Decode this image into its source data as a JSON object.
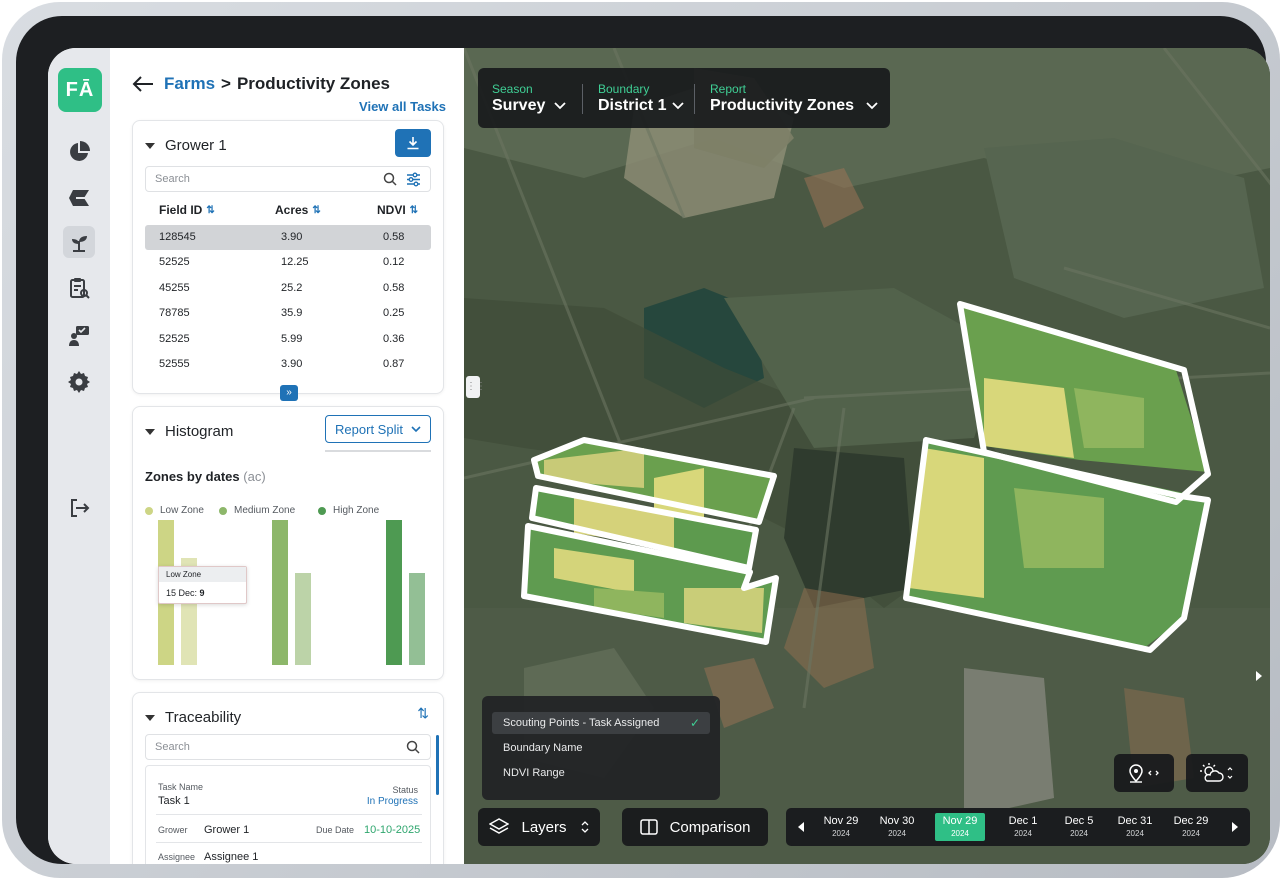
{
  "app": {
    "logo_text": "FĀ"
  },
  "rail": {
    "items": [
      {
        "icon": "pie-chart-icon"
      },
      {
        "icon": "field-layers-icon"
      },
      {
        "icon": "plant-icon",
        "active": true
      },
      {
        "icon": "report-clipboard-icon"
      },
      {
        "icon": "scout-chat-icon"
      },
      {
        "icon": "gear-icon"
      },
      {
        "icon": "logout-icon"
      }
    ]
  },
  "breadcrumb": {
    "parent": "Farms",
    "separator": ">",
    "current": "Productivity Zones"
  },
  "view_all_tasks": "View all Tasks",
  "grower": {
    "title": "Grower 1",
    "search_placeholder": "Search",
    "columns": [
      "Field ID",
      "Acres",
      "NDVI"
    ],
    "sort_glyph": "⇅",
    "rows": [
      {
        "field_id": "128545",
        "acres": "3.90",
        "ndvi": "0.58",
        "selected": true
      },
      {
        "field_id": "52525",
        "acres": "12.25",
        "ndvi": "0.12"
      },
      {
        "field_id": "45255",
        "acres": "25.2",
        "ndvi": "0.58"
      },
      {
        "field_id": "78785",
        "acres": "35.9",
        "ndvi": "0.25"
      },
      {
        "field_id": "52525",
        "acres": "5.99",
        "ndvi": "0.36"
      },
      {
        "field_id": "52555",
        "acres": "3.90",
        "ndvi": "0.87"
      }
    ],
    "expand_glyph": "»"
  },
  "histogram": {
    "title": "Histogram",
    "split_button": "Report Split",
    "zones_title": "Zones by dates",
    "zones_unit": "(ac)",
    "legend": [
      {
        "label": "Low Zone",
        "color": "#cdd585"
      },
      {
        "label": "Medium Zone",
        "color": "#8db76a"
      },
      {
        "label": "High Zone",
        "color": "#4e9a52"
      }
    ],
    "tooltip": {
      "title": "Low Zone",
      "label": "15 Dec:",
      "value": "9"
    }
  },
  "chart_data": {
    "type": "bar",
    "title": "Zones by dates",
    "ylabel": "(ac)",
    "series": [
      {
        "name": "Low Zone",
        "values": [
          12.1,
          8.9
        ]
      },
      {
        "name": "Medium Zone",
        "values": [
          12.1,
          7.7
        ]
      },
      {
        "name": "High Zone",
        "values": [
          12.1,
          7.7
        ]
      }
    ],
    "series_colors": [
      [
        "#cdd585",
        "#e0e4b5"
      ],
      [
        "#8db76a",
        "#bcd3a8"
      ],
      [
        "#4e9a52",
        "#93bf95"
      ]
    ],
    "ylim": [
      0,
      14
    ],
    "grid": false,
    "legend_position": "top-left"
  },
  "traceability": {
    "title": "Traceability",
    "search_placeholder": "Search",
    "task": {
      "task_name_label": "Task Name",
      "task_name": "Task 1",
      "status_label": "Status",
      "status": "In Progress",
      "grower_label": "Grower",
      "grower": "Grower 1",
      "due_label": "Due Date",
      "due_date": "10-10-2025",
      "assignee_label": "Assignee",
      "assignee": "Assignee 1"
    }
  },
  "map": {
    "filters": [
      {
        "label": "Season",
        "value": "Survey"
      },
      {
        "label": "Boundary",
        "value": "District 1"
      },
      {
        "label": "Report",
        "value": "Productivity Zones"
      }
    ],
    "layer_menu": [
      {
        "label": "Scouting Points - Task Assigned",
        "checked": true
      },
      {
        "label": "Boundary Name",
        "checked": false
      },
      {
        "label": "NDVI Range",
        "checked": false
      }
    ],
    "layers_button": "Layers",
    "comparison_button": "Comparison",
    "timeline": [
      {
        "date": "Nov 29",
        "year": "2024"
      },
      {
        "date": "Nov 30",
        "year": "2024"
      },
      {
        "date": "Nov 29",
        "year": "2024",
        "active": true
      },
      {
        "date": "Dec 1",
        "year": "2024"
      },
      {
        "date": "Dec 5",
        "year": "2024"
      },
      {
        "date": "Dec 31",
        "year": "2024"
      },
      {
        "date": "Dec 29",
        "year": "2024"
      }
    ],
    "zone_colors": {
      "low": "#d8d77a",
      "medium": "#8fb55e",
      "high": "#4f9a4c"
    }
  }
}
